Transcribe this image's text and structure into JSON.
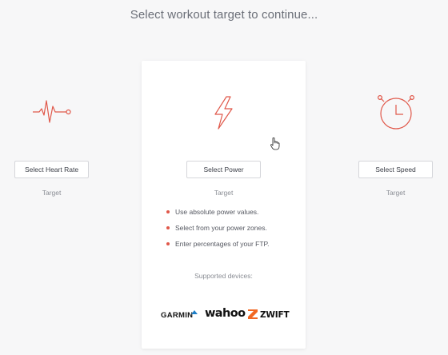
{
  "header": {
    "title": "Select workout target to continue..."
  },
  "accent_color": "#e0584a",
  "options": {
    "heart_rate": {
      "icon": "heart-rate-icon",
      "button_label": "Select Heart Rate",
      "sublabel": "Target"
    },
    "power": {
      "icon": "lightning-icon",
      "button_label": "Select Power",
      "sublabel": "Target",
      "features": [
        "Use absolute power values.",
        "Select from your power zones.",
        "Enter percentages of your FTP."
      ],
      "supported_label": "Supported devices:",
      "devices": [
        "GARMIN",
        "wahoo",
        "ZWIFT"
      ]
    },
    "speed": {
      "icon": "stopwatch-icon",
      "button_label": "Select Speed",
      "sublabel": "Target"
    }
  }
}
